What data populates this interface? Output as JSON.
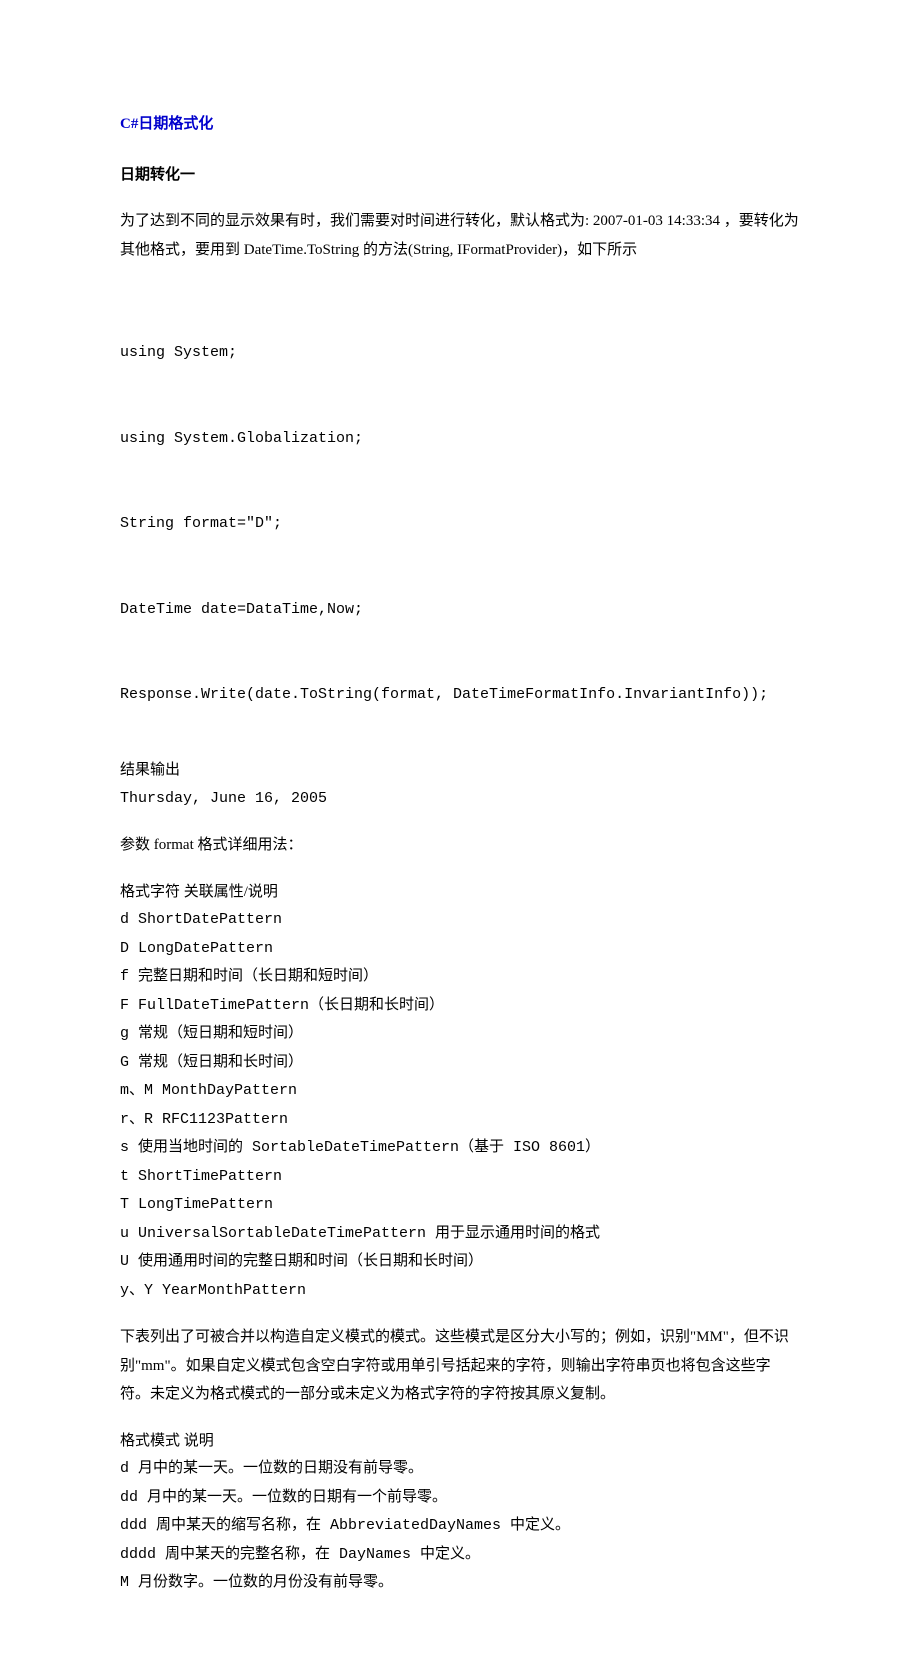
{
  "title": "C#日期格式化",
  "heading1": "日期转化一",
  "intro": "为了达到不同的显示效果有时，我们需要对时间进行转化，默认格式为: 2007-01-03 14:33:34 ，要转化为其他格式，要用到 DateTime.ToString 的方法(String, IFormatProvider)，如下所示",
  "code": [
    "using System;",
    "using System.Globalization;",
    "String format=\"D\";",
    "DateTime date=DataTime,Now;",
    "Response.Write(date.ToString(format, DateTimeFormatInfo.InvariantInfo));"
  ],
  "output_label": "结果输出",
  "output_value": "Thursday, June 16, 2005",
  "param_intro": "参数 format 格式详细用法：",
  "table1_header": "格式字符 关联属性/说明",
  "table1": [
    "d ShortDatePattern",
    "D LongDatePattern",
    "f 完整日期和时间（长日期和短时间）",
    "F FullDateTimePattern（长日期和长时间）",
    "g 常规（短日期和短时间）",
    "G 常规（短日期和长时间）",
    "m、M MonthDayPattern",
    "r、R RFC1123Pattern",
    "s 使用当地时间的 SortableDateTimePattern（基于 ISO 8601）",
    "t ShortTimePattern",
    "T LongTimePattern",
    "u UniversalSortableDateTimePattern 用于显示通用时间的格式",
    "U 使用通用时间的完整日期和时间（长日期和长时间）",
    "y、Y YearMonthPattern"
  ],
  "note": "下表列出了可被合并以构造自定义模式的模式。这些模式是区分大小写的；例如，识别\"MM\"，但不识别\"mm\"。如果自定义模式包含空白字符或用单引号括起来的字符，则输出字符串页也将包含这些字符。未定义为格式模式的一部分或未定义为格式字符的字符按其原义复制。",
  "table2_header": "格式模式 说明",
  "table2": [
    "d 月中的某一天。一位数的日期没有前导零。",
    "dd 月中的某一天。一位数的日期有一个前导零。",
    "ddd 周中某天的缩写名称，在 AbbreviatedDayNames 中定义。",
    "dddd 周中某天的完整名称，在 DayNames 中定义。",
    "M 月份数字。一位数的月份没有前导零。"
  ]
}
